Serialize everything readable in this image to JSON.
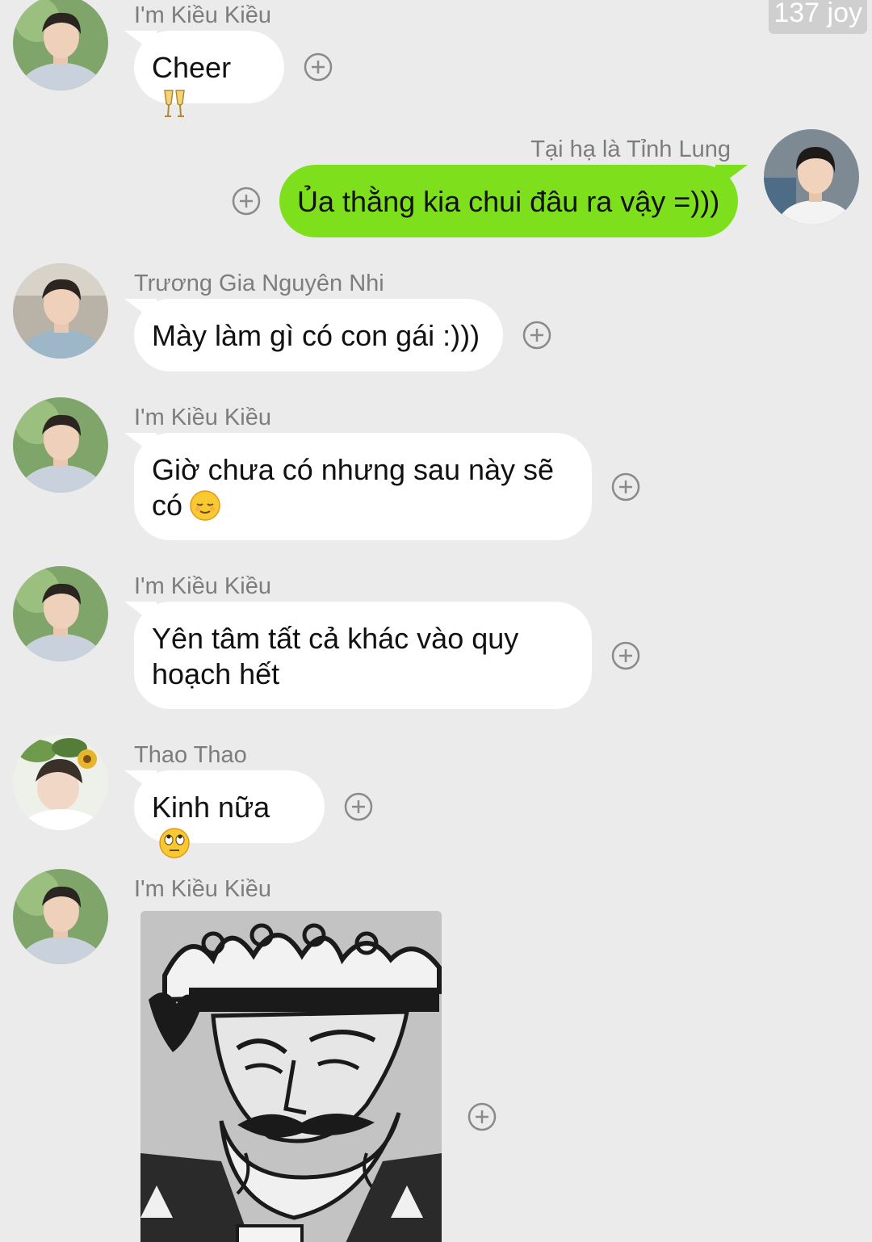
{
  "watermark": "137 joy",
  "messages": [
    {
      "sender": "I'm Kiều Kiều",
      "text": "Cheer",
      "emoji": "clinking-glasses-emoji"
    },
    {
      "sender": "Tại hạ là Tỉnh Lung",
      "text": "Ủa thằng kia chui đâu ra vậy =)))"
    },
    {
      "sender": "Trương Gia Nguyên Nhi",
      "text": "Mày làm gì có con gái :)))"
    },
    {
      "sender": "I'm Kiều Kiều",
      "line1": "Giờ chưa có nhưng sau này sẽ",
      "line2": "có",
      "emoji": "relieved-face-emoji"
    },
    {
      "sender": "I'm Kiều Kiều",
      "line1": "Yên tâm tất cả khác vào quy",
      "line2": "hoạch hết"
    },
    {
      "sender": "Thao Thao",
      "text": "Kinh nữa",
      "emoji": "eye-roll-emoji"
    },
    {
      "sender": "I'm Kiều Kiều",
      "image": "king-of-hearts-card-meme"
    }
  ],
  "icons": {
    "reaction": "add-reaction-icon"
  },
  "colors": {
    "background": "#ebebeb",
    "incoming_bubble": "#ffffff",
    "outgoing_bubble": "#7ee01d",
    "sender_name": "#7d7d7d"
  }
}
